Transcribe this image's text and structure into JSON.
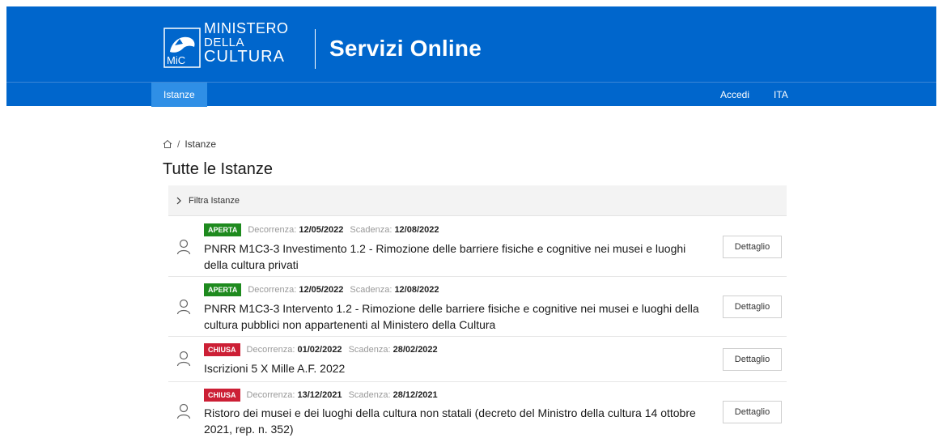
{
  "brand": {
    "logo_mark": "MiC",
    "logo_line1": "MINISTERO",
    "logo_line2": "DELLA",
    "logo_line3": "CULTURA",
    "site_title": "Servizi Online",
    "primary_color": "#0066cc"
  },
  "nav": {
    "active_tab": "Istanze",
    "login": "Accedi",
    "language": "ITA"
  },
  "breadcrumb": {
    "home_icon": "home-icon",
    "separator": "/",
    "current": "Istanze"
  },
  "page": {
    "title": "Tutte le Istanze"
  },
  "filter": {
    "label": "Filtra Istanze",
    "icon": "chevron-right-icon"
  },
  "labels": {
    "decorrenza": "Decorrenza:",
    "scadenza": "Scadenza:",
    "detail_button": "Dettaglio"
  },
  "items": [
    {
      "status": "APERTA",
      "status_color": "#1e8a1e",
      "decorrenza": "12/05/2022",
      "scadenza": "12/08/2022",
      "title": "PNRR M1C3-3 Investimento 1.2 - Rimozione delle barriere fisiche e cognitive nei musei e luoghi della cultura privati"
    },
    {
      "status": "APERTA",
      "status_color": "#1e8a1e",
      "decorrenza": "12/05/2022",
      "scadenza": "12/08/2022",
      "title": "PNRR M1C3-3 Intervento 1.2 - Rimozione delle barriere fisiche e cognitive nei musei e luoghi della cultura pubblici non appartenenti al Ministero della Cultura"
    },
    {
      "status": "CHIUSA",
      "status_color": "#cc1f35",
      "decorrenza": "01/02/2022",
      "scadenza": "28/02/2022",
      "title": "Iscrizioni 5 X Mille A.F. 2022"
    },
    {
      "status": "CHIUSA",
      "status_color": "#cc1f35",
      "decorrenza": "13/12/2021",
      "scadenza": "28/12/2021",
      "title": "Ristoro dei musei e dei luoghi della cultura non statali (decreto del Ministro della cultura 14 ottobre 2021, rep. n. 352)"
    }
  ]
}
